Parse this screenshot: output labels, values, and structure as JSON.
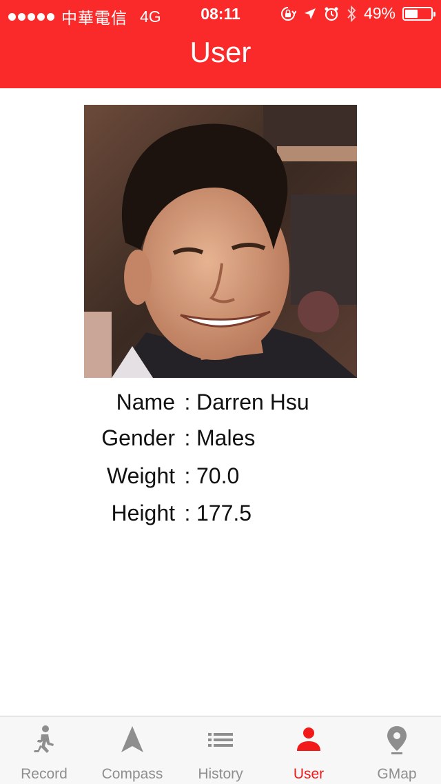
{
  "status_bar": {
    "carrier": "中華電信",
    "network": "4G",
    "time": "08:11",
    "battery": "49%",
    "battery_level": 0.49
  },
  "nav": {
    "title": "User"
  },
  "profile": {
    "fields": [
      {
        "label": "Name",
        "separator": ":",
        "value": "Darren Hsu"
      },
      {
        "label": "Gender",
        "separator": ":",
        "value": "Males"
      },
      {
        "label": "Weight",
        "separator": ":",
        "value": "70.0"
      },
      {
        "label": "Height",
        "separator": ":",
        "value": "177.5"
      }
    ]
  },
  "tabs": [
    {
      "label": "Record",
      "icon": "running-person-icon"
    },
    {
      "label": "Compass",
      "icon": "compass-arrow-icon"
    },
    {
      "label": "History",
      "icon": "list-icon"
    },
    {
      "label": "User",
      "icon": "user-icon",
      "active": true
    },
    {
      "label": "GMap",
      "icon": "map-pin-icon"
    }
  ],
  "colors": {
    "accent": "#fb2a2a",
    "tab_active": "#f2191a",
    "tab_inactive": "#8e8e8e"
  }
}
